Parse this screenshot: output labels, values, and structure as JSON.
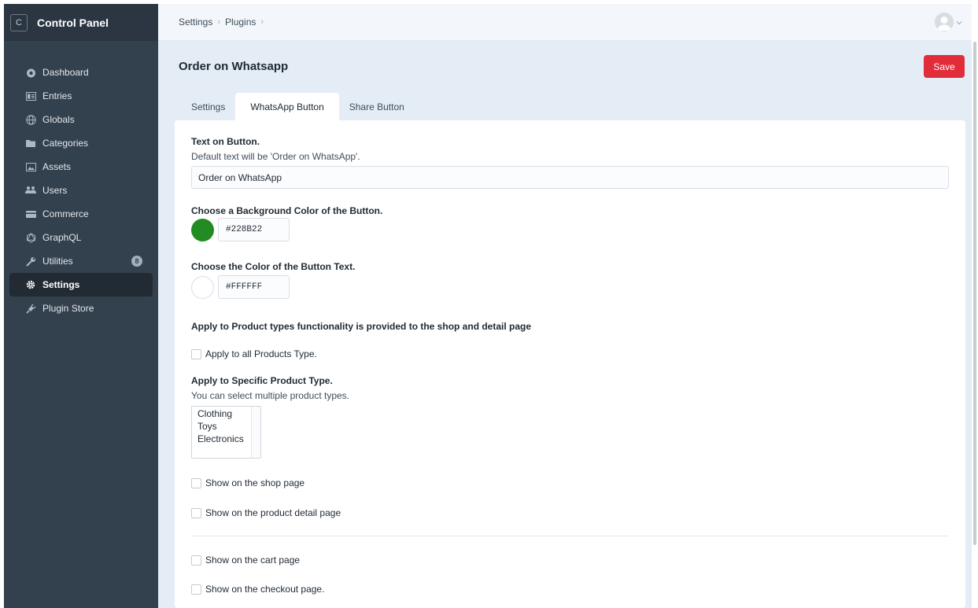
{
  "brand": {
    "logo_letter": "C",
    "title": "Control Panel"
  },
  "sidebar": {
    "items": [
      {
        "label": "Dashboard",
        "icon": "dashboard-icon"
      },
      {
        "label": "Entries",
        "icon": "entries-icon"
      },
      {
        "label": "Globals",
        "icon": "globe-icon"
      },
      {
        "label": "Categories",
        "icon": "folder-icon"
      },
      {
        "label": "Assets",
        "icon": "image-icon"
      },
      {
        "label": "Users",
        "icon": "users-icon"
      },
      {
        "label": "Commerce",
        "icon": "credit-card-icon"
      },
      {
        "label": "GraphQL",
        "icon": "graphql-icon"
      },
      {
        "label": "Utilities",
        "icon": "wrench-icon",
        "badge": "8"
      },
      {
        "label": "Settings",
        "icon": "gear-icon",
        "active": true
      },
      {
        "label": "Plugin Store",
        "icon": "plug-icon"
      }
    ]
  },
  "breadcrumb": {
    "items": [
      "Settings",
      "Plugins"
    ],
    "separator": "›"
  },
  "page": {
    "title": "Order on Whatsapp",
    "save_label": "Save"
  },
  "tabs": [
    {
      "label": "Settings"
    },
    {
      "label": "WhatsApp Button",
      "active": true
    },
    {
      "label": "Share Button"
    }
  ],
  "form": {
    "text_on_button": {
      "label": "Text on Button.",
      "help": "Default text will be 'Order on WhatsApp'.",
      "value": "Order on WhatsApp"
    },
    "bg_color": {
      "label": "Choose a Background Color of the Button.",
      "value": "#228B22"
    },
    "text_color": {
      "label": "Choose the Color of the Button Text.",
      "value": "#FFFFFF"
    },
    "apply_heading": "Apply to Product types functionality is provided to the shop and detail page",
    "apply_all": "Apply to all Products Type.",
    "specific": {
      "label": "Apply to Specific Product Type.",
      "help": "You can select multiple product types.",
      "options": [
        "Clothing",
        "Toys",
        "Electronics"
      ]
    },
    "show_shop": "Show on the shop page",
    "show_detail": "Show on the product detail page",
    "show_cart": "Show on the cart page",
    "show_checkout": "Show on the checkout page."
  },
  "colors": {
    "accent": "#e12d39",
    "sidebar_bg": "#33404d",
    "swatch_bg": "#228B22",
    "swatch_text": "#FFFFFF"
  }
}
